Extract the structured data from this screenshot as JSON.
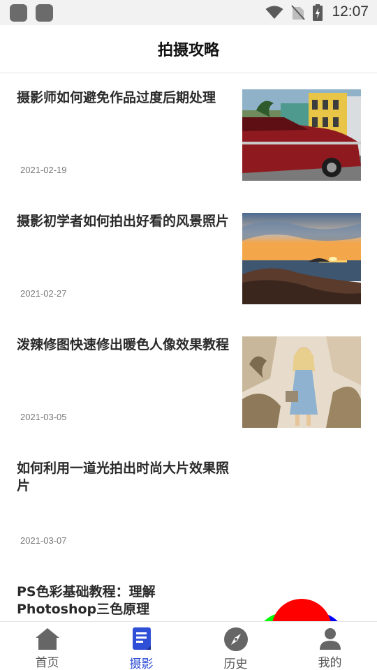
{
  "status_bar": {
    "time": "12:07",
    "icons": [
      "app-notification-icon",
      "app-notification-icon",
      "wifi-icon",
      "no-signal-icon",
      "battery-charging-icon"
    ]
  },
  "header": {
    "title": "拍摄攻略"
  },
  "articles": [
    {
      "title": "摄影师如何避免作品过度后期处理",
      "date": "2021-02-19",
      "thumbnail": "red-vintage-car-street-photo"
    },
    {
      "title": "摄影初学者如何拍出好看的风景照片",
      "date": "2021-02-27",
      "thumbnail": "sunset-seascape-photo"
    },
    {
      "title": "泼辣修图快速修出暖色人像效果教程",
      "date": "2021-03-05",
      "thumbnail": "woman-portrait-warm-tone-photo"
    },
    {
      "title": "如何利用一道光拍出时尚大片效果照片",
      "date": "2021-03-07",
      "thumbnail": ""
    },
    {
      "title": "PS色彩基础教程：理解Photoshop三色原理",
      "date": "",
      "thumbnail": "rgb-color-circles-diagram"
    }
  ],
  "tab_bar": {
    "active_index": 1,
    "active_color": "#2f4fd6",
    "tabs": [
      {
        "label": "首页",
        "icon": "home-icon"
      },
      {
        "label": "摄影",
        "icon": "document-icon"
      },
      {
        "label": "历史",
        "icon": "compass-icon"
      },
      {
        "label": "我的",
        "icon": "person-icon"
      }
    ]
  }
}
